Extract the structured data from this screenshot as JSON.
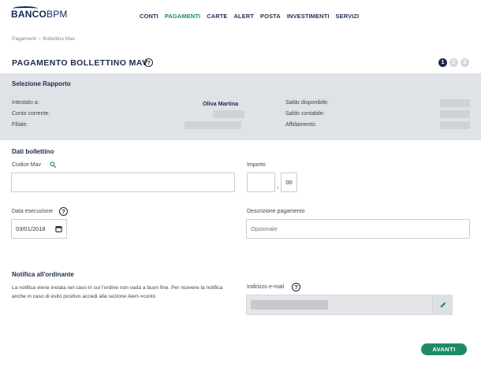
{
  "brand": {
    "part1": "BANCO",
    "part2": "BPM"
  },
  "nav": {
    "items": [
      {
        "label": "CONTI",
        "active": false
      },
      {
        "label": "PAGAMENTI",
        "active": true
      },
      {
        "label": "CARTE",
        "active": false
      },
      {
        "label": "ALERT",
        "active": false
      },
      {
        "label": "POSTA",
        "active": false
      },
      {
        "label": "INVESTIMENTI",
        "active": false
      },
      {
        "label": "SERVIZI",
        "active": false
      }
    ]
  },
  "breadcrumb": {
    "first": "Pagamenti",
    "separator": "›",
    "second": "Bollettino Mav"
  },
  "page": {
    "title": "PAGAMENTO BOLLETTINO MAV",
    "help": "?"
  },
  "steps": [
    "1",
    "2",
    "3"
  ],
  "rapporto": {
    "title": "Selezione Rapporto",
    "intestato_label": "Intestato a:",
    "intestato_value": "Oliva Martina",
    "conto_label": "Conto corrente:",
    "filiale_label": "Filiale:",
    "saldo_disp_label": "Saldo disponibile:",
    "saldo_cont_label": "Saldo contabile:",
    "affidamento_label": "Affidamento:"
  },
  "bollettino": {
    "title": "Dati bollettino",
    "codice_label": "Codice Mav",
    "codice_value": "",
    "importo_label": "Importo",
    "importo_int": "",
    "importo_sep": ",",
    "importo_dec": "00",
    "data_label": "Data esecuzione",
    "data_value": "03/01/2018",
    "descrizione_label": "Descrizione pagamento",
    "descrizione_placeholder": "Opzionale"
  },
  "notifica": {
    "title": "Notifica all'ordinante",
    "text": "La notifica viene inviata nel caso in cui l'ordine non vada a buon fine. Per ricevere la notifica anche in caso di esito positivo accedi alla sezione Alert->conto",
    "email_label": "Indirizzo e-mail"
  },
  "buttons": {
    "next": "AVANTI"
  },
  "colors": {
    "accent": "#1e8a66",
    "navy": "#1d2a4a",
    "panel": "#dfe2e6"
  }
}
